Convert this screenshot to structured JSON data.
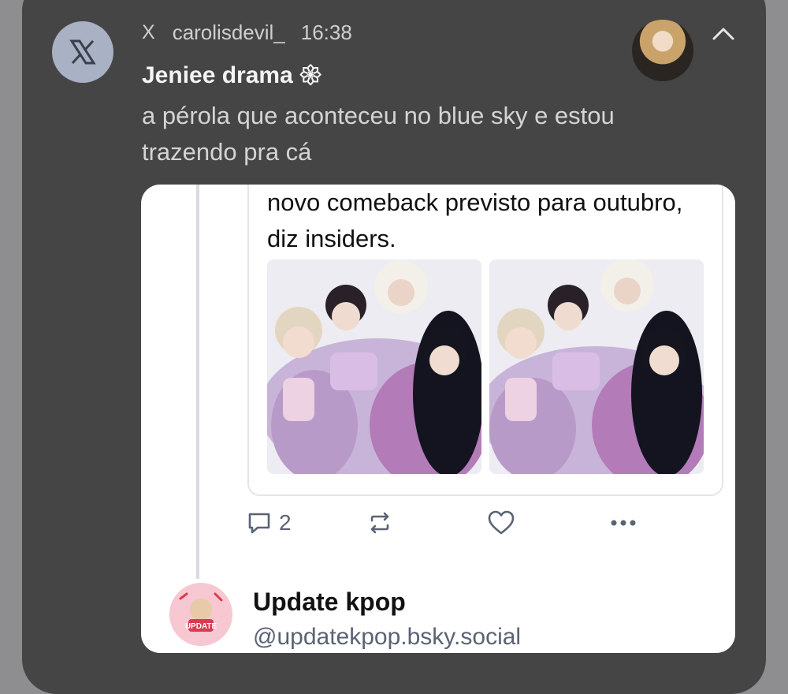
{
  "notification": {
    "app_name": "X",
    "app_icon": "x-logo-icon",
    "username": "carolisdevil_",
    "time": "16:38",
    "title": "Jeniee drama 𑁍",
    "body": "a pérola que aconteceu no blue sky e estou trazendo pra cá",
    "collapse_icon": "chevron-up-icon"
  },
  "embedded_post": {
    "text": "novo comeback previsto para outubro, diz insiders.",
    "reply_count": "2",
    "icons": [
      "reply-icon",
      "repost-icon",
      "like-icon",
      "more-icon"
    ]
  },
  "profile": {
    "display_name": "Update kpop",
    "handle": "@updatekpop.bsky.social",
    "avatar_text": "UPDATE"
  },
  "colors": {
    "notification_bg": "#454545",
    "card_bg": "#ffffff",
    "muted_text": "#5b6275"
  }
}
